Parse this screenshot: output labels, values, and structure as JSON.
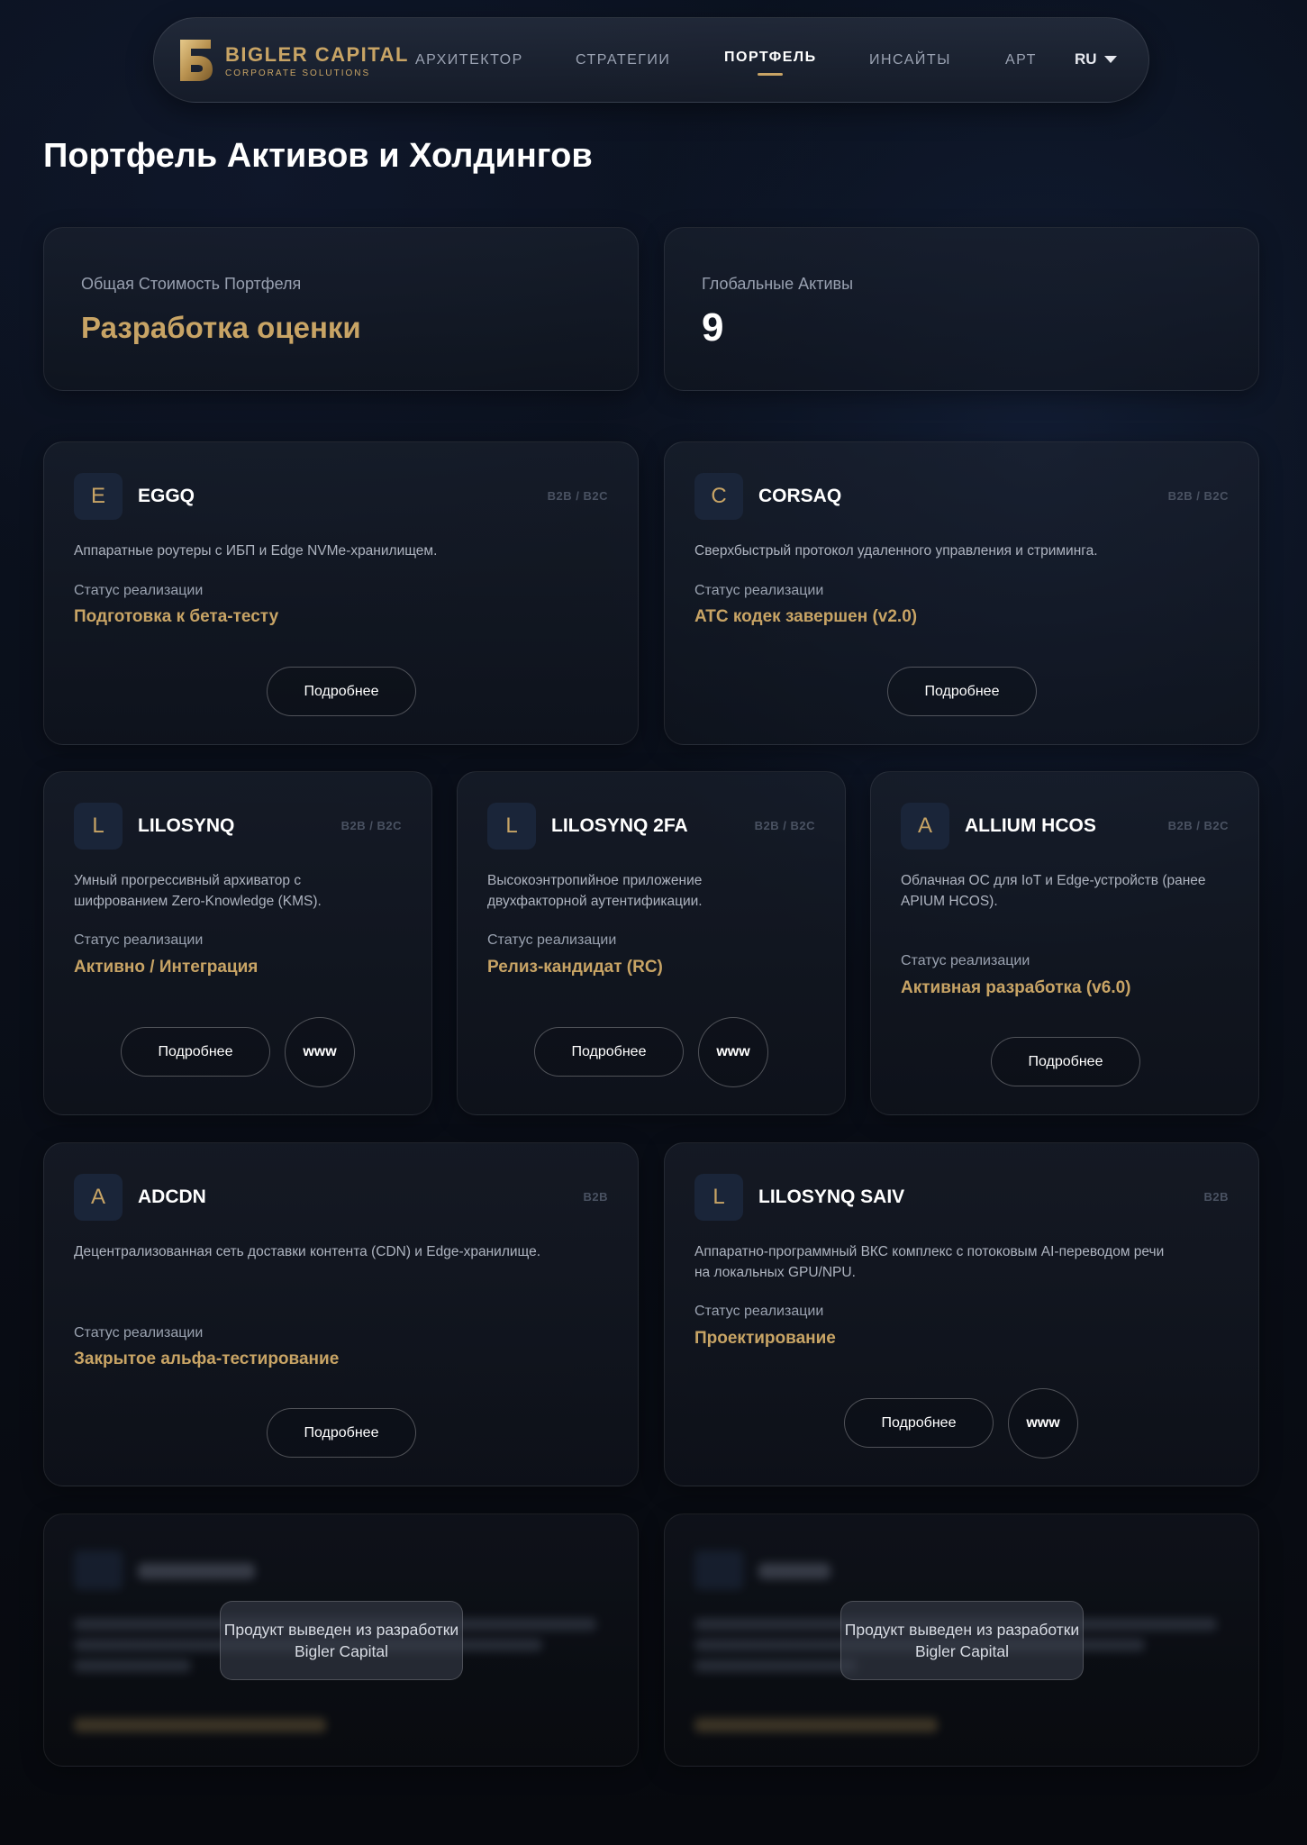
{
  "brand": {
    "name": "BIGLER CAPITAL",
    "subtitle": "CORPORATE SOLUTIONS",
    "mark": "Б",
    "accent": "#c8a465"
  },
  "nav": {
    "items": [
      "АРХИТЕКТОР",
      "СТРАТЕГИИ",
      "ПОРТФЕЛЬ",
      "ИНСАЙТЫ",
      "АРТ"
    ],
    "active": "ПОРТФЕЛЬ",
    "lang": "RU"
  },
  "page": {
    "title": "Портфель Активов и Холдингов"
  },
  "stats": {
    "total_label": "Общая Стоимость Портфеля",
    "total_value": "Разработка оценки",
    "assets_label": "Глобальные Активы",
    "assets_value": "9"
  },
  "common": {
    "status_label": "Статус реализации",
    "more_label": "Подробнее",
    "www_label": "www",
    "retired_note": "Продукт выведен из разработки Bigler Capital"
  },
  "products": [
    {
      "letter": "E",
      "name": "EGGQ",
      "tag": "B2B / B2C",
      "description": "Аппаратные роутеры с ИБП и Edge NVMe-хранилищем.",
      "status": "Подготовка к бета-тесту"
    },
    {
      "letter": "C",
      "name": "CORSAQ",
      "tag": "B2B / B2C",
      "description": "Сверхбыстрый протокол удаленного управления и стриминга.",
      "status": "ATC кодек завершен (v2.0)"
    },
    {
      "letter": "L",
      "name": "LILOSYNQ",
      "tag": "B2B / B2C",
      "description_lines": [
        "Умный прогрессивный архиватор с",
        "шифрованием Zero-Knowledge (KMS)."
      ],
      "status": "Активно / Интеграция"
    },
    {
      "letter": "L",
      "name": "LILOSYNQ 2FA",
      "tag": "B2B / B2C",
      "description_lines": [
        "Высокоэнтропийное приложение",
        "двухфакторной аутентификации."
      ],
      "status": "Релиз-кандидат (RC)"
    },
    {
      "letter": "A",
      "name": "ALLIUM HCOS",
      "tag": "B2B / B2C",
      "description_lines": [
        "Облачная ОС для IoT и Edge-устройств (ранее",
        "APIUM HCOS)."
      ],
      "status": "Активная разработка (v6.0)"
    },
    {
      "letter": "A",
      "name": "ADCDN",
      "tag": "B2B",
      "description": "Децентрализованная сеть доставки контента (CDN) и Edge-хранилище.",
      "status": "Закрытое альфа-тестирование"
    },
    {
      "letter": "L",
      "name": "LILOSYNQ SAIV",
      "tag": "B2B",
      "description_lines": [
        "Аппаратно-программный ВКС комплекс с потоковым AI-переводом речи",
        "на локальных GPU/NPU."
      ],
      "status": "Проектирование"
    }
  ]
}
